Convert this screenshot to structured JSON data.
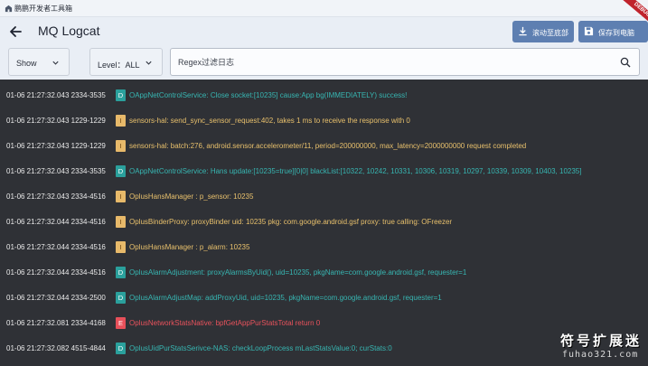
{
  "window": {
    "title": "鹏鹏开发者工具箱"
  },
  "appbar": {
    "title": "MQ Logcat",
    "scroll_button": "滚动至底部",
    "save_button": "保存到电脑",
    "ribbon": "DEBUG"
  },
  "filters": {
    "show": "Show",
    "level": "Level：ALL",
    "search_placeholder": "Regex过滤日志"
  },
  "level_colors": {
    "D": "#2aa09c",
    "I": "#e7b96a",
    "E": "#e7505a"
  },
  "logs": [
    {
      "meta": "01-06 21:27:32.043 2334-3535",
      "level": "D",
      "message": "OAppNetControlService: Close socket:[10235] cause:App bg(IMMEDIATELY) success!"
    },
    {
      "meta": "01-06 21:27:32.043 1229-1229",
      "level": "I",
      "message": "sensors-hal: send_sync_sensor_request:402, takes 1 ms to receive the response with 0"
    },
    {
      "meta": "01-06 21:27:32.043 1229-1229",
      "level": "I",
      "message": "sensors-hal: batch:276, android.sensor.accelerometer/11, period=200000000, max_latency=2000000000 request completed"
    },
    {
      "meta": "01-06 21:27:32.043 2334-3535",
      "level": "D",
      "message": "OAppNetControlService: Hans update:[10235=true][0|0] blackList:[10322, 10242, 10331, 10306, 10319, 10297, 10339, 10309, 10403, 10235]"
    },
    {
      "meta": "01-06 21:27:32.043 2334-4516",
      "level": "I",
      "message": "OplusHansManager : p_sensor: 10235"
    },
    {
      "meta": "01-06 21:27:32.044 2334-4516",
      "level": "I",
      "message": "OplusBinderProxy: proxyBinder uid: 10235 pkg: com.google.android.gsf proxy: true calling: OFreezer"
    },
    {
      "meta": "01-06 21:27:32.044 2334-4516",
      "level": "I",
      "message": "OplusHansManager : p_alarm: 10235"
    },
    {
      "meta": "01-06 21:27:32.044 2334-4516",
      "level": "D",
      "message": "OplusAlarmAdjustment: proxyAlarmsByUid(), uid=10235, pkgName=com.google.android.gsf, requester=1"
    },
    {
      "meta": "01-06 21:27:32.044 2334-2500",
      "level": "D",
      "message": "OplusAlarmAdjustMap: addProxyUid, uid=10235, pkgName=com.google.android.gsf, requester=1"
    },
    {
      "meta": "01-06 21:27:32.081 2334-4168",
      "level": "E",
      "message": "OplusNetworkStatsNative: bpfGetAppPurStatsTotal return 0"
    },
    {
      "meta": "01-06 21:27:32.082 4515-4844",
      "level": "D",
      "message": "OplusUidPurStatsSerivce-NAS: checkLoopProcess mLastStatsValue:0; curStats:0"
    }
  ],
  "watermark": {
    "main": "符号扩展迷",
    "sub": "fuhao321.com"
  }
}
